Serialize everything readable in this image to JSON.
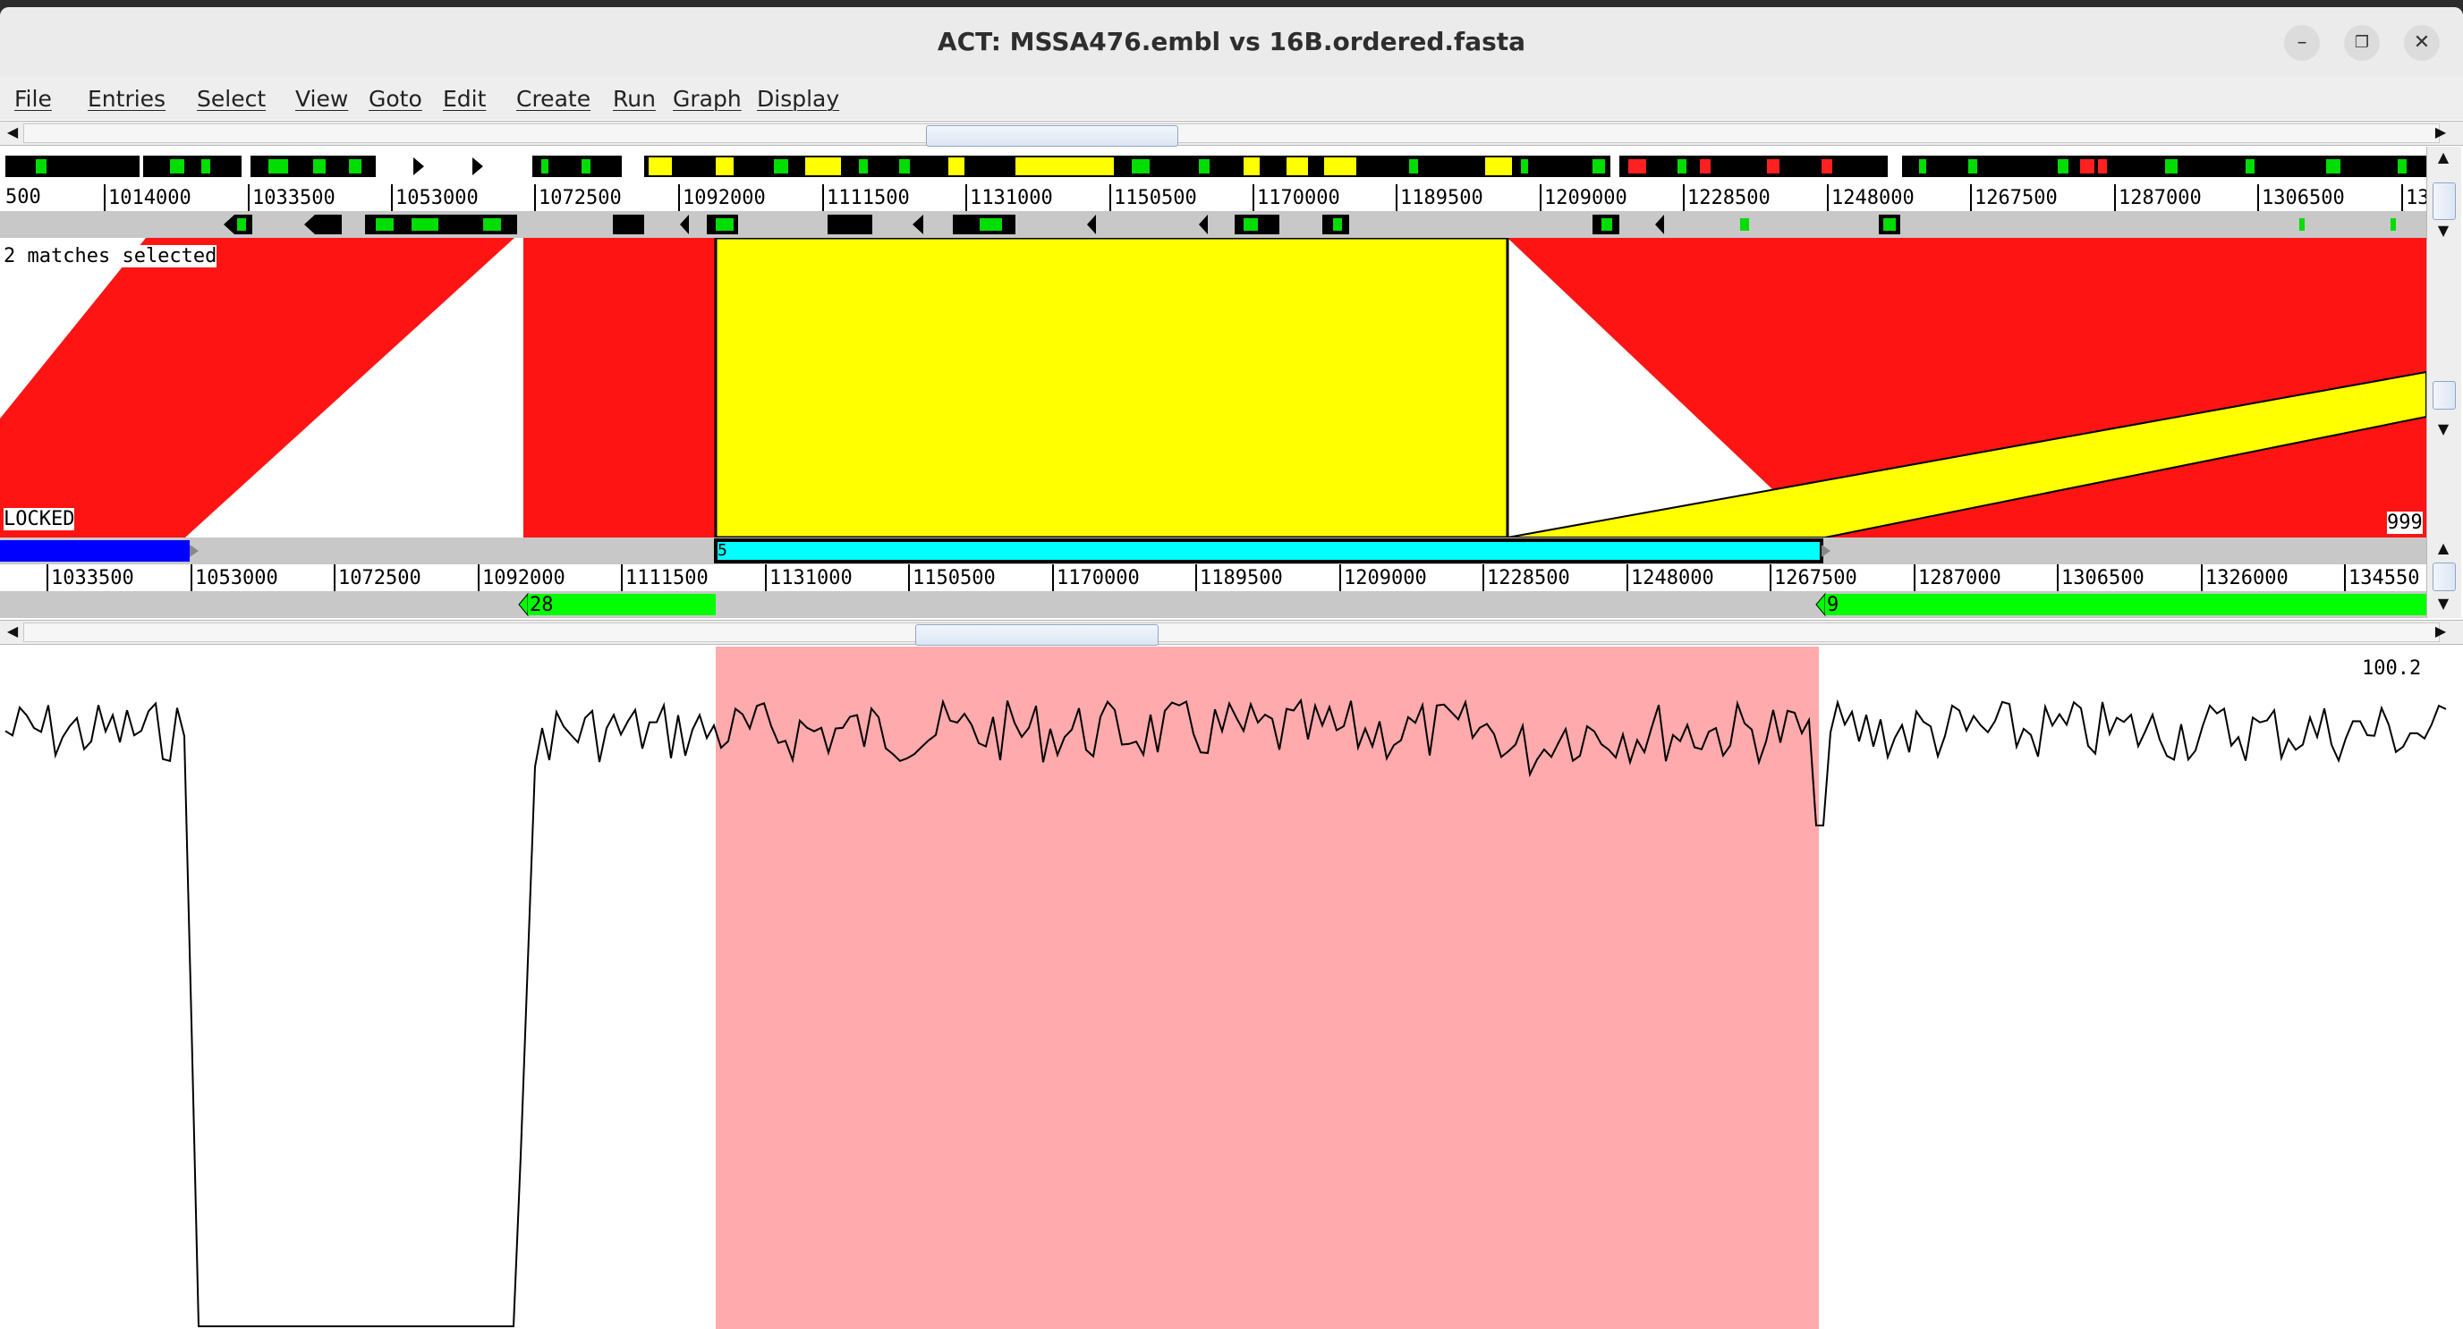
{
  "window": {
    "title": "ACT: MSSA476.embl vs 16B.ordered.fasta"
  },
  "menu": [
    "File",
    "Entries",
    "Select",
    "View",
    "Goto",
    "Edit",
    "Create",
    "Run",
    "Graph",
    "Display"
  ],
  "top_ruler": {
    "first_label": "500",
    "labels": [
      "1014000",
      "1033500",
      "1053000",
      "1072500",
      "1092000",
      "1111500",
      "1131000",
      "1150500",
      "1170000",
      "1189500",
      "1209000",
      "1228500",
      "1248000",
      "1267500",
      "1287000",
      "1306500",
      "13"
    ]
  },
  "bottom_ruler": {
    "labels": [
      "1033500",
      "1053000",
      "1072500",
      "1092000",
      "1111500",
      "1131000",
      "1150500",
      "1170000",
      "1189500",
      "1209000",
      "1228500",
      "1248000",
      "1267500",
      "1287000",
      "1306500",
      "1326000",
      "134550"
    ]
  },
  "comparison": {
    "status": "2 matches selected",
    "locked": "LOCKED",
    "right_value": "999"
  },
  "bottom_features": {
    "left_label": "28",
    "right_label": "9",
    "selected_label": "5"
  },
  "graph": {
    "max_label": "100.2"
  },
  "colors": {
    "match": "#ff1414",
    "selected_match": "#ffff00",
    "feature": "#00e000",
    "selected_feature": "#00ffff",
    "blue_feature": "#0000ff",
    "graph_highlight": "#ffaaac"
  }
}
